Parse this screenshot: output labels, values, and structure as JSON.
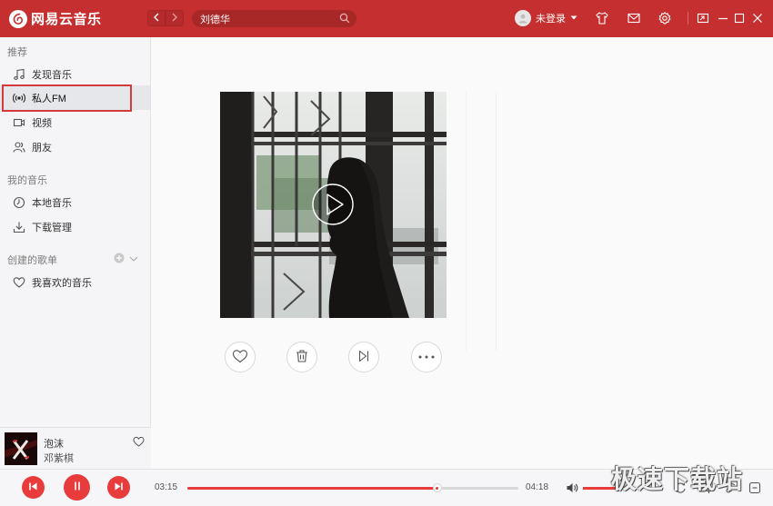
{
  "app": {
    "name": "网易云音乐",
    "brand_color": "#c62f2f",
    "accent_color": "#e83c3c"
  },
  "header": {
    "back_icon": "chevron-left-icon",
    "forward_icon": "chevron-right-icon",
    "search": {
      "value": "刘德华",
      "icon": "search-icon"
    },
    "user_label": "未登录",
    "icons": [
      "skin-icon",
      "mail-icon",
      "settings-icon",
      "mini-mode-icon",
      "minimize-icon",
      "maximize-icon",
      "close-icon"
    ]
  },
  "sidebar": {
    "section_recommend": "推荐",
    "items_recommend": [
      {
        "label": "发现音乐",
        "icon": "music-note-icon"
      },
      {
        "label": "私人FM",
        "icon": "radio-icon",
        "active": true
      },
      {
        "label": "视频",
        "icon": "video-icon"
      },
      {
        "label": "朋友",
        "icon": "friends-icon"
      }
    ],
    "section_mymusic": "我的音乐",
    "items_mymusic": [
      {
        "label": "本地音乐",
        "icon": "local-music-icon"
      },
      {
        "label": "下载管理",
        "icon": "download-icon"
      }
    ],
    "section_playlists": "创建的歌单",
    "items_playlists": [
      {
        "label": "我喜欢的音乐",
        "icon": "heart-icon"
      }
    ]
  },
  "now_playing": {
    "title": "泡沫",
    "artist": "邓紫棋"
  },
  "fm": {
    "actions": [
      "like-icon",
      "trash-icon",
      "next-icon",
      "more-icon"
    ]
  },
  "player": {
    "current_time": "03:15",
    "total_time": "04:18",
    "progress": 0.755,
    "volume": 0.8
  },
  "watermark": "极速下载站"
}
